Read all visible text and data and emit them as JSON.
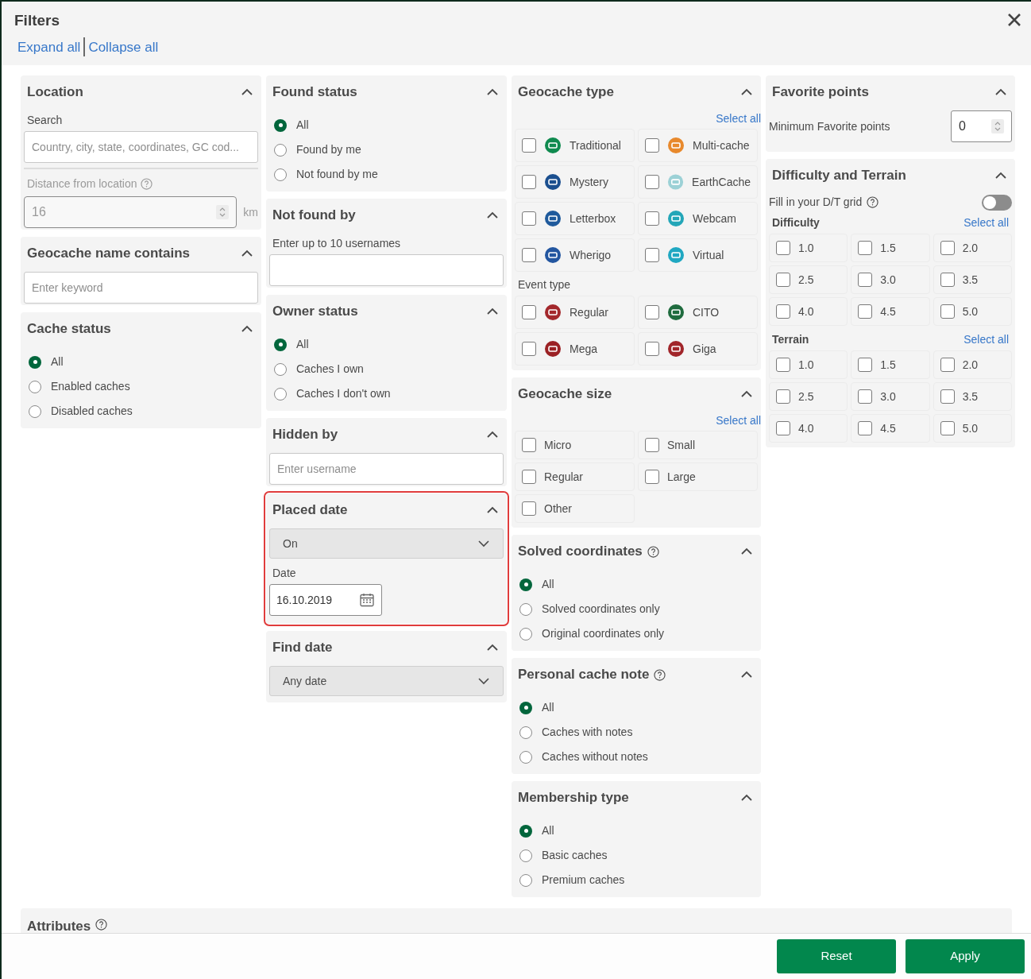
{
  "window": {
    "title": "Filters"
  },
  "header_links": [
    "Expand all",
    "Collapse all"
  ],
  "columns": [
    [
      {
        "title": "Location",
        "expanded": true,
        "highlighted": false,
        "blocks": [
          {
            "kind": "label",
            "text": "Search",
            "disabled": false
          },
          {
            "kind": "text_field",
            "placeholder": "Country, city, state, coordinates, GC cod..."
          },
          {
            "kind": "divider"
          },
          {
            "kind": "label",
            "text": "Distance from location",
            "disabled": true,
            "help": true
          },
          {
            "kind": "number_field",
            "value": "16",
            "unit": "km",
            "disabled": true
          }
        ]
      },
      {
        "title": "Geocache name contains",
        "expanded": true,
        "highlighted": false,
        "blocks": [
          {
            "kind": "text_field",
            "placeholder": "Enter keyword"
          }
        ]
      },
      {
        "title": "Cache status",
        "expanded": true,
        "highlighted": false,
        "blocks": [
          {
            "kind": "radios",
            "options": [
              {
                "label": "All",
                "selected": true
              },
              {
                "label": "Enabled caches",
                "selected": false
              },
              {
                "label": "Disabled caches",
                "selected": false
              }
            ]
          }
        ]
      }
    ],
    [
      {
        "title": "Found status",
        "expanded": true,
        "highlighted": false,
        "blocks": [
          {
            "kind": "radios",
            "options": [
              {
                "label": "All",
                "selected": true
              },
              {
                "label": "Found by me",
                "selected": false
              },
              {
                "label": "Not found by me",
                "selected": false
              }
            ]
          }
        ]
      },
      {
        "title": "Not found by",
        "expanded": true,
        "highlighted": false,
        "blocks": [
          {
            "kind": "label",
            "text": "Enter up to 10 usernames",
            "disabled": false
          },
          {
            "kind": "text_field"
          }
        ]
      },
      {
        "title": "Owner status",
        "expanded": true,
        "highlighted": false,
        "blocks": [
          {
            "kind": "radios",
            "options": [
              {
                "label": "All",
                "selected": true
              },
              {
                "label": "Caches I own",
                "selected": false
              },
              {
                "label": "Caches I don't own",
                "selected": false
              }
            ]
          }
        ]
      },
      {
        "title": "Hidden by",
        "expanded": true,
        "highlighted": false,
        "blocks": [
          {
            "kind": "text_field",
            "placeholder": "Enter username"
          }
        ]
      },
      {
        "title": "Placed date",
        "expanded": true,
        "highlighted": true,
        "blocks": [
          {
            "kind": "dropdown",
            "value": "On"
          },
          {
            "kind": "label",
            "text": "Date",
            "disabled": false
          },
          {
            "kind": "date_field",
            "value": "16.10.2019"
          }
        ]
      },
      {
        "title": "Find date",
        "expanded": true,
        "highlighted": false,
        "blocks": [
          {
            "kind": "dropdown",
            "value": "Any date"
          }
        ]
      }
    ],
    [
      {
        "title": "Geocache type",
        "expanded": true,
        "highlighted": false,
        "blocks": [
          {
            "kind": "select_all",
            "text": "Select all"
          },
          {
            "kind": "type_grid",
            "items": [
              {
                "label": "Traditional",
                "checked": false,
                "color": "#0f8a4f"
              },
              {
                "label": "Multi-cache",
                "checked": false,
                "color": "#e8892c"
              },
              {
                "label": "Mystery",
                "checked": false,
                "color": "#1b4f8f"
              },
              {
                "label": "EarthCache",
                "checked": false,
                "color": "#9cd1d6"
              },
              {
                "label": "Letterbox",
                "checked": false,
                "color": "#1f5a9c"
              },
              {
                "label": "Webcam",
                "checked": false,
                "color": "#23a6b8"
              },
              {
                "label": "Wherigo",
                "checked": false,
                "color": "#2356a0"
              },
              {
                "label": "Virtual",
                "checked": false,
                "color": "#20a8c2"
              }
            ]
          },
          {
            "kind": "label",
            "text": "Event type",
            "disabled": false
          },
          {
            "kind": "type_grid",
            "items": [
              {
                "label": "Regular",
                "checked": false,
                "color": "#a3282c"
              },
              {
                "label": "CITO",
                "checked": false,
                "color": "#1f6b3e"
              },
              {
                "label": "Mega",
                "checked": false,
                "color": "#9b2124"
              },
              {
                "label": "Giga",
                "checked": false,
                "color": "#a1252a"
              }
            ]
          }
        ]
      },
      {
        "title": "Geocache size",
        "expanded": true,
        "highlighted": false,
        "blocks": [
          {
            "kind": "select_all",
            "text": "Select all"
          },
          {
            "kind": "size_grid",
            "items": [
              {
                "label": "Micro",
                "checked": false
              },
              {
                "label": "Small",
                "checked": false
              },
              {
                "label": "Regular",
                "checked": false
              },
              {
                "label": "Large",
                "checked": false
              },
              {
                "label": "Other",
                "checked": false
              }
            ]
          }
        ]
      },
      {
        "title": "Solved coordinates",
        "expanded": true,
        "help": true,
        "highlighted": false,
        "blocks": [
          {
            "kind": "radios",
            "options": [
              {
                "label": "All",
                "selected": true
              },
              {
                "label": "Solved coordinates only",
                "selected": false
              },
              {
                "label": "Original coordinates only",
                "selected": false
              }
            ]
          }
        ]
      },
      {
        "title": "Personal cache note",
        "expanded": true,
        "help": true,
        "highlighted": false,
        "blocks": [
          {
            "kind": "radios",
            "options": [
              {
                "label": "All",
                "selected": true
              },
              {
                "label": "Caches with notes",
                "selected": false
              },
              {
                "label": "Caches without notes",
                "selected": false
              }
            ]
          }
        ]
      },
      {
        "title": "Membership type",
        "expanded": true,
        "highlighted": false,
        "blocks": [
          {
            "kind": "radios",
            "options": [
              {
                "label": "All",
                "selected": true
              },
              {
                "label": "Basic caches",
                "selected": false
              },
              {
                "label": "Premium caches",
                "selected": false
              }
            ]
          }
        ]
      }
    ],
    [
      {
        "title": "Favorite points",
        "expanded": true,
        "highlighted": false,
        "blocks": [
          {
            "kind": "inline_number",
            "text": "Minimum Favorite points",
            "value": "0"
          }
        ]
      },
      {
        "title": "Difficulty and Terrain",
        "expanded": true,
        "highlighted": false,
        "blocks": [
          {
            "kind": "toggle",
            "text": "Fill in your D/T grid",
            "on": false,
            "help": true
          },
          {
            "kind": "subheading",
            "text": "Difficulty",
            "link": "Select all"
          },
          {
            "kind": "rating_grid",
            "items": [
              {
                "label": "1.0",
                "checked": false
              },
              {
                "label": "1.5",
                "checked": false
              },
              {
                "label": "2.0",
                "checked": false
              },
              {
                "label": "2.5",
                "checked": false
              },
              {
                "label": "3.0",
                "checked": false
              },
              {
                "label": "3.5",
                "checked": false
              },
              {
                "label": "4.0",
                "checked": false
              },
              {
                "label": "4.5",
                "checked": false
              },
              {
                "label": "5.0",
                "checked": false
              }
            ]
          },
          {
            "kind": "subheading",
            "text": "Terrain",
            "link": "Select all"
          },
          {
            "kind": "rating_grid",
            "items": [
              {
                "label": "1.0",
                "checked": false
              },
              {
                "label": "1.5",
                "checked": false
              },
              {
                "label": "2.0",
                "checked": false
              },
              {
                "label": "2.5",
                "checked": false
              },
              {
                "label": "3.0",
                "checked": false
              },
              {
                "label": "3.5",
                "checked": false
              },
              {
                "label": "4.0",
                "checked": false
              },
              {
                "label": "4.5",
                "checked": false
              },
              {
                "label": "5.0",
                "checked": false
              }
            ]
          }
        ]
      }
    ]
  ],
  "attributes": {
    "title": "Attributes",
    "help": true
  },
  "buttons": [
    "Reset",
    "Apply"
  ]
}
